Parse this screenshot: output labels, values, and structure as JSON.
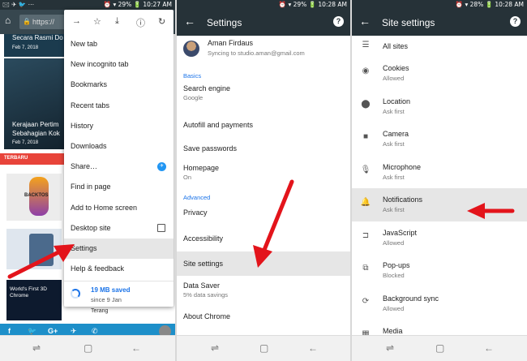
{
  "panel1": {
    "status": {
      "icons": "🖂 ✈ 🐦 ⋯",
      "right": "⏰ ▾ 29% 🔋 10:27 AM"
    },
    "url_text": "https://",
    "article1": {
      "title": "Secara Rasmi Do",
      "date": "Feb 7, 2018"
    },
    "article2": {
      "title": "Kerajaan Pertim",
      "title2": "Sebahagian Kok",
      "date": "Feb 7, 2018"
    },
    "section_label": "TERBARU",
    "thumb_text": "BACKTOS",
    "thumb3_text": "World's First 3D Chrome",
    "article4": {
      "title": "Terang"
    },
    "menu": {
      "items": [
        {
          "label": "New tab"
        },
        {
          "label": "New incognito tab"
        },
        {
          "label": "Bookmarks"
        },
        {
          "label": "Recent tabs"
        },
        {
          "label": "History"
        },
        {
          "label": "Downloads"
        },
        {
          "label": "Share…"
        },
        {
          "label": "Find in page"
        },
        {
          "label": "Add to Home screen"
        },
        {
          "label": "Desktop site"
        },
        {
          "label": "Settings"
        },
        {
          "label": "Help & feedback"
        }
      ],
      "saved_amount": "19 MB saved",
      "saved_since": "since 9 Jan"
    }
  },
  "panel2": {
    "status_right": "⏰ ▾ 29% 🔋 10:28 AM",
    "title": "Settings",
    "account": {
      "name": "Aman Firdaus",
      "email": "Syncing to studio.aman@gmail.com"
    },
    "basics_label": "Basics",
    "basics": [
      {
        "label": "Search engine",
        "sub": "Google"
      },
      {
        "label": "Autofill and payments",
        "sub": ""
      },
      {
        "label": "Save passwords",
        "sub": ""
      },
      {
        "label": "Homepage",
        "sub": "On"
      }
    ],
    "advanced_label": "Advanced",
    "advanced": [
      {
        "label": "Privacy",
        "sub": ""
      },
      {
        "label": "Accessibility",
        "sub": ""
      },
      {
        "label": "Site settings",
        "sub": ""
      },
      {
        "label": "Data Saver",
        "sub": "5% data savings"
      },
      {
        "label": "About Chrome",
        "sub": ""
      }
    ]
  },
  "panel3": {
    "status_right": "⏰ ▾ 28% 🔋 10:28 AM",
    "title": "Site settings",
    "items": [
      {
        "label": "All sites",
        "sub": "",
        "icon": "list-icon"
      },
      {
        "label": "Cookies",
        "sub": "Allowed",
        "icon": "cookie-icon"
      },
      {
        "label": "Location",
        "sub": "Ask first",
        "icon": "location-pin-icon"
      },
      {
        "label": "Camera",
        "sub": "Ask first",
        "icon": "camera-icon"
      },
      {
        "label": "Microphone",
        "sub": "Ask first",
        "icon": "microphone-icon"
      },
      {
        "label": "Notifications",
        "sub": "Ask first",
        "icon": "bell-icon"
      },
      {
        "label": "JavaScript",
        "sub": "Allowed",
        "icon": "javascript-icon"
      },
      {
        "label": "Pop-ups",
        "sub": "Blocked",
        "icon": "popup-icon"
      },
      {
        "label": "Background sync",
        "sub": "Allowed",
        "icon": "sync-icon"
      },
      {
        "label": "Media",
        "sub": "",
        "icon": "media-icon"
      }
    ]
  },
  "colors": {
    "toolbar": "#263238",
    "accent": "#1a73e8",
    "arrow": "#e3141b",
    "social_bar": "#1d8fc9"
  }
}
